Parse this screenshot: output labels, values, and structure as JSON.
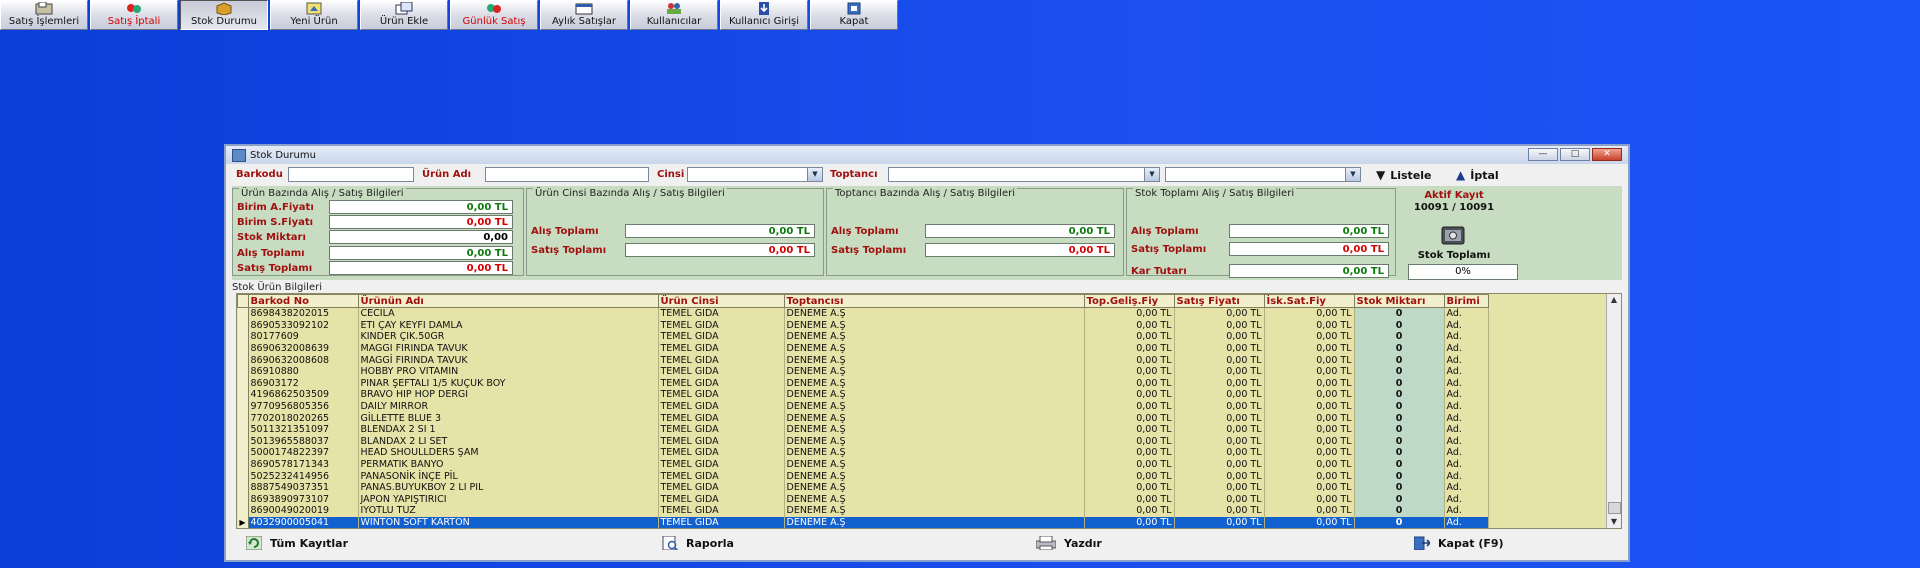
{
  "toolbar": [
    {
      "label": "Satış İşlemleri",
      "icon": "register-icon",
      "state": "normal"
    },
    {
      "label": "Satış İptali",
      "icon": "cancel-sale-icon",
      "state": "red"
    },
    {
      "label": "Stok Durumu",
      "icon": "box-icon",
      "state": "active"
    },
    {
      "label": "Yeni Ürün",
      "icon": "new-product-icon",
      "state": "normal"
    },
    {
      "label": "Ürün Ekle",
      "icon": "add-product-icon",
      "state": "normal"
    },
    {
      "label": "Günlük Satış",
      "icon": "daily-sales-icon",
      "state": "red"
    },
    {
      "label": "Aylık Satışlar",
      "icon": "monthly-sales-icon",
      "state": "normal"
    },
    {
      "label": "Kullanıcılar",
      "icon": "users-icon",
      "state": "normal"
    },
    {
      "label": "Kullanıcı Girişi",
      "icon": "login-icon",
      "state": "normal"
    },
    {
      "label": "Kapat",
      "icon": "exit-icon",
      "state": "normal"
    }
  ],
  "window": {
    "title": "Stok Durumu",
    "controls": [
      "—",
      "□",
      "✕"
    ]
  },
  "filters": {
    "barkod_label": "Barkodu",
    "urun_adi_label": "Ürün Adı",
    "cinsi_label": "Cinsi",
    "toptanci_label": "Toptancı",
    "listele": "Listele",
    "iptal": "İptal"
  },
  "groups": {
    "urun": {
      "title": "Ürün Bazında Alış / Satış Bilgileri",
      "rows": [
        {
          "label": "Birim A.Fiyatı",
          "value": "0,00 TL",
          "color": "green"
        },
        {
          "label": "Birim S.Fiyatı",
          "value": "0,00 TL",
          "color": "red"
        },
        {
          "label": "Stok Miktarı",
          "value": "0,00",
          "color": "black"
        },
        {
          "label": "Alış Toplamı",
          "value": "0,00 TL",
          "color": "green"
        },
        {
          "label": "Satış Toplamı",
          "value": "0,00 TL",
          "color": "red"
        }
      ]
    },
    "cins": {
      "title": "Ürün Cinsi Bazında Alış / Satış Bilgileri",
      "rows": [
        {
          "label": "Alış Toplamı",
          "value": "0,00 TL",
          "color": "green"
        },
        {
          "label": "Satış Toplamı",
          "value": "0,00 TL",
          "color": "red"
        }
      ]
    },
    "toptanci": {
      "title": "Toptancı Bazında Alış / Satış Bilgileri",
      "rows": [
        {
          "label": "Alış Toplamı",
          "value": "0,00 TL",
          "color": "green"
        },
        {
          "label": "Satış Toplamı",
          "value": "0,00 TL",
          "color": "red"
        }
      ]
    },
    "stok": {
      "title": "Stok Toplamı Alış / Satış Bilgileri",
      "rows": [
        {
          "label": "Alış Toplamı",
          "value": "0,00 TL",
          "color": "green"
        },
        {
          "label": "Satış Toplamı",
          "value": "0,00 TL",
          "color": "red"
        },
        {
          "label": "Kar Tutarı",
          "value": "0,00 TL",
          "color": "green"
        }
      ]
    }
  },
  "aktif": {
    "title": "Aktif Kayıt",
    "value": "10091 / 10091"
  },
  "stok_toplami": {
    "label": "Stok Toplamı",
    "percent": "0%"
  },
  "grid": {
    "title": "Stok Ürün Bilgileri",
    "columns": [
      "Barkod No",
      "Ürünün Adı",
      "Ürün Cinsi",
      "Toptancısı",
      "Top.Geliş.Fiy",
      "Satış Fiyatı",
      "İsk.Sat.Fiy",
      "Stok Miktarı",
      "Birimi"
    ],
    "rows": [
      [
        "8698438202015",
        "CECİLA",
        "TEMEL GIDA",
        "DENEME A.Ş",
        "0,00 TL",
        "0,00 TL",
        "0,00 TL",
        "0",
        "Ad."
      ],
      [
        "8690533092102",
        "ETİ ÇAY KEYFİ DAMLA",
        "TEMEL GIDA",
        "DENEME A.Ş",
        "0,00 TL",
        "0,00 TL",
        "0,00 TL",
        "0",
        "Ad."
      ],
      [
        "80177609",
        "KİNDER ÇİK.50GR",
        "TEMEL GIDA",
        "DENEME A.Ş",
        "0,00 TL",
        "0,00 TL",
        "0,00 TL",
        "0",
        "Ad."
      ],
      [
        "8690632008639",
        "MAGGİ FIRINDA TAVUK",
        "TEMEL GIDA",
        "DENEME A.Ş",
        "0,00 TL",
        "0,00 TL",
        "0,00 TL",
        "0",
        "Ad."
      ],
      [
        "8690632008608",
        "MAGGİ FIRINDA TAVUK",
        "TEMEL GIDA",
        "DENEME A.Ş",
        "0,00 TL",
        "0,00 TL",
        "0,00 TL",
        "0",
        "Ad."
      ],
      [
        "86910880",
        "HOBBY PRO VİTAMİN",
        "TEMEL GIDA",
        "DENEME A.Ş",
        "0,00 TL",
        "0,00 TL",
        "0,00 TL",
        "0",
        "Ad."
      ],
      [
        "86903172",
        "PINAR ŞEFTALİ 1/5 KÜÇÜK BOY",
        "TEMEL GIDA",
        "DENEME A.Ş",
        "0,00 TL",
        "0,00 TL",
        "0,00 TL",
        "0",
        "Ad."
      ],
      [
        "4196862503509",
        "BRAVO HİP HOP DERGİ",
        "TEMEL GIDA",
        "DENEME A.Ş",
        "0,00 TL",
        "0,00 TL",
        "0,00 TL",
        "0",
        "Ad."
      ],
      [
        "9770956805356",
        "DAILY MIRROR",
        "TEMEL GIDA",
        "DENEME A.Ş",
        "0,00 TL",
        "0,00 TL",
        "0,00 TL",
        "0",
        "Ad."
      ],
      [
        "7702018020265",
        "GİLLETTE BLUE 3",
        "TEMEL GIDA",
        "DENEME A.Ş",
        "0,00 TL",
        "0,00 TL",
        "0,00 TL",
        "0",
        "Ad."
      ],
      [
        "5011321351097",
        "BLENDAX 2 Sİ 1",
        "TEMEL GIDA",
        "DENEME A.Ş",
        "0,00 TL",
        "0,00 TL",
        "0,00 TL",
        "0",
        "Ad."
      ],
      [
        "5013965588037",
        "BLANDAX 2 Lİ SET",
        "TEMEL GIDA",
        "DENEME A.Ş",
        "0,00 TL",
        "0,00 TL",
        "0,00 TL",
        "0",
        "Ad."
      ],
      [
        "5000174822397",
        "HEAD SHOULLDERS ŞAM",
        "TEMEL GIDA",
        "DENEME A.Ş",
        "0,00 TL",
        "0,00 TL",
        "0,00 TL",
        "0",
        "Ad."
      ],
      [
        "8690578171343",
        "PERMATİK BANYO",
        "TEMEL GIDA",
        "DENEME A.Ş",
        "0,00 TL",
        "0,00 TL",
        "0,00 TL",
        "0",
        "Ad."
      ],
      [
        "5025232414956",
        "PANASONİK İNÇE PİL",
        "TEMEL GIDA",
        "DENEME A.Ş",
        "0,00 TL",
        "0,00 TL",
        "0,00 TL",
        "0",
        "Ad."
      ],
      [
        "8887549037351",
        "PANAS.BÜYÜKBOY 2 Lİ PİL",
        "TEMEL GIDA",
        "DENEME A.Ş",
        "0,00 TL",
        "0,00 TL",
        "0,00 TL",
        "0",
        "Ad."
      ],
      [
        "8693890973107",
        "JAPON YAPIŞTIRICI",
        "TEMEL GIDA",
        "DENEME A.Ş",
        "0,00 TL",
        "0,00 TL",
        "0,00 TL",
        "0",
        "Ad."
      ],
      [
        "8690049020019",
        "İYOTLU TUZ",
        "TEMEL GIDA",
        "DENEME A.Ş",
        "0,00 TL",
        "0,00 TL",
        "0,00 TL",
        "0",
        "Ad."
      ],
      [
        "4032900005041",
        "WİNTON SOFT KARTON",
        "TEMEL GIDA",
        "DENEME A.Ş",
        "0,00 TL",
        "0,00 TL",
        "0,00 TL",
        "0",
        "Ad."
      ]
    ],
    "selected_row": 18
  },
  "bottom": {
    "tum": "Tüm Kayıtlar",
    "rapor": "Raporla",
    "yazdir": "Yazdır",
    "kapat": "Kapat (F9)"
  },
  "colors": {
    "accent": "#1060d0",
    "label_red": "#a01010",
    "value_green": "#0b7a0b",
    "value_red": "#d40000"
  }
}
